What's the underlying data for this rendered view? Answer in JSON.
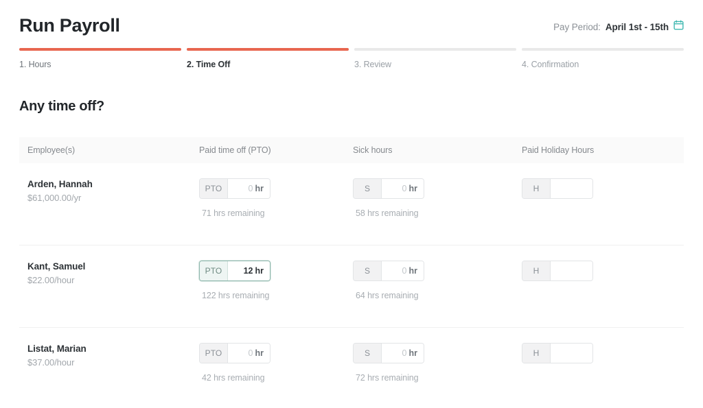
{
  "header": {
    "title": "Run Payroll",
    "pay_period_label": "Pay Period:",
    "pay_period_value": "April 1st - 15th",
    "calendar_icon": "calendar-icon",
    "calendar_color": "#3fb8b0"
  },
  "stepper": {
    "accent_color": "#e8664f",
    "inactive_color": "#e9e9e9",
    "steps": [
      {
        "label": "1. Hours",
        "state": "done"
      },
      {
        "label": "2. Time Off",
        "state": "active"
      },
      {
        "label": "3. Review",
        "state": "upcoming"
      },
      {
        "label": "4. Confirmation",
        "state": "upcoming"
      }
    ]
  },
  "section": {
    "heading": "Any time off?"
  },
  "table": {
    "columns": {
      "employee": "Employee(s)",
      "pto": "Paid time off (PTO)",
      "sick": "Sick hours",
      "holiday": "Paid Holiday Hours"
    },
    "rows": [
      {
        "name": "Arden, Hannah",
        "rate": "$61,000.00/yr",
        "pto": {
          "prefix": "PTO",
          "value": "0",
          "unit": "hr",
          "remaining": "71 hrs remaining",
          "focused": false
        },
        "sick": {
          "prefix": "S",
          "value": "0",
          "unit": "hr",
          "remaining": "58 hrs remaining",
          "focused": false
        },
        "holiday": {
          "prefix": "H",
          "value": "",
          "unit": "",
          "remaining": "",
          "focused": false
        }
      },
      {
        "name": "Kant, Samuel",
        "rate": "$22.00/hour",
        "pto": {
          "prefix": "PTO",
          "value": "12",
          "unit": "hr",
          "remaining": "122 hrs remaining",
          "focused": true
        },
        "sick": {
          "prefix": "S",
          "value": "0",
          "unit": "hr",
          "remaining": "64 hrs remaining",
          "focused": false
        },
        "holiday": {
          "prefix": "H",
          "value": "",
          "unit": "",
          "remaining": "",
          "focused": false
        }
      },
      {
        "name": "Listat, Marian",
        "rate": "$37.00/hour",
        "pto": {
          "prefix": "PTO",
          "value": "0",
          "unit": "hr",
          "remaining": "42 hrs remaining",
          "focused": false
        },
        "sick": {
          "prefix": "S",
          "value": "0",
          "unit": "hr",
          "remaining": "72 hrs remaining",
          "focused": false
        },
        "holiday": {
          "prefix": "H",
          "value": "",
          "unit": "",
          "remaining": "",
          "focused": false
        }
      }
    ]
  }
}
